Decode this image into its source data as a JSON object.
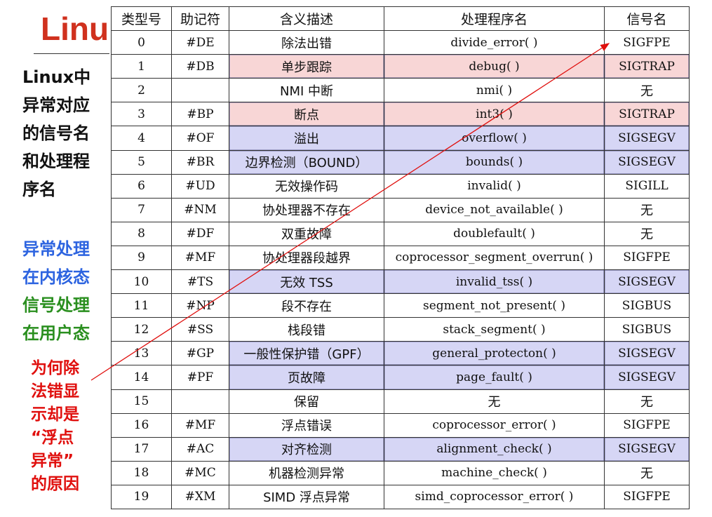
{
  "title": "Linu",
  "side_notes": {
    "intro": [
      "Linux中",
      "异常对应",
      "的信号名",
      "和处理程",
      "序名"
    ],
    "kernel": [
      "异常处理",
      "在内核态"
    ],
    "user": [
      "信号处理",
      "在用户态"
    ],
    "question": [
      "为何除",
      "法错显",
      "示却是",
      "“浮点",
      "异常”",
      "的原因"
    ]
  },
  "table": {
    "headers": [
      "类型号",
      "助记符",
      "含义描述",
      "处理程序名",
      "信号名"
    ],
    "rows": [
      {
        "num": "0",
        "mn": "#DE",
        "desc": "除法出错",
        "handler": "divide_error( )",
        "signal": "SIGFPE",
        "hl": ""
      },
      {
        "num": "1",
        "mn": "#DB",
        "desc": "单步跟踪",
        "handler": "debug( )",
        "signal": "SIGTRAP",
        "hl": "pink"
      },
      {
        "num": "2",
        "mn": "",
        "desc": "NMI 中断",
        "handler": "nmi( )",
        "signal": "无",
        "hl": ""
      },
      {
        "num": "3",
        "mn": "#BP",
        "desc": "断点",
        "handler": "int3( )",
        "signal": "SIGTRAP",
        "hl": "pink"
      },
      {
        "num": "4",
        "mn": "#OF",
        "desc": "溢出",
        "handler": "overflow( )",
        "signal": "SIGSEGV",
        "hl": "blue"
      },
      {
        "num": "5",
        "mn": "#BR",
        "desc": "边界检测（BOUND）",
        "handler": "bounds( )",
        "signal": "SIGSEGV",
        "hl": "blue"
      },
      {
        "num": "6",
        "mn": "#UD",
        "desc": "无效操作码",
        "handler": "invalid( )",
        "signal": "SIGILL",
        "hl": ""
      },
      {
        "num": "7",
        "mn": "#NM",
        "desc": "协处理器不存在",
        "handler": "device_not_available( )",
        "signal": "无",
        "hl": ""
      },
      {
        "num": "8",
        "mn": "#DF",
        "desc": "双重故障",
        "handler": "doublefault( )",
        "signal": "无",
        "hl": ""
      },
      {
        "num": "9",
        "mn": "#MF",
        "desc": "协处理器段越界",
        "handler": "coprocessor_segment_overrun( )",
        "signal": "SIGFPE",
        "hl": ""
      },
      {
        "num": "10",
        "mn": "#TS",
        "desc": "无效 TSS",
        "handler": "invalid_tss( )",
        "signal": "SIGSEGV",
        "hl": "blue"
      },
      {
        "num": "11",
        "mn": "#NP",
        "desc": "段不存在",
        "handler": "segment_not_present( )",
        "signal": "SIGBUS",
        "hl": ""
      },
      {
        "num": "12",
        "mn": "#SS",
        "desc": "栈段错",
        "handler": "stack_segment( )",
        "signal": "SIGBUS",
        "hl": ""
      },
      {
        "num": "13",
        "mn": "#GP",
        "desc": "一般性保护错（GPF）",
        "handler": "general_protecton( )",
        "signal": "SIGSEGV",
        "hl": "blue"
      },
      {
        "num": "14",
        "mn": "#PF",
        "desc": "页故障",
        "handler": "page_fault( )",
        "signal": "SIGSEGV",
        "hl": "blue"
      },
      {
        "num": "15",
        "mn": "",
        "desc": "保留",
        "handler": "无",
        "signal": "无",
        "hl": ""
      },
      {
        "num": "16",
        "mn": "#MF",
        "desc": "浮点错误",
        "handler": "coprocessor_error( )",
        "signal": "SIGFPE",
        "hl": ""
      },
      {
        "num": "17",
        "mn": "#AC",
        "desc": "对齐检测",
        "handler": "alignment_check( )",
        "signal": "SIGSEGV",
        "hl": "blue"
      },
      {
        "num": "18",
        "mn": "#MC",
        "desc": "机器检测异常",
        "handler": "machine_check( )",
        "signal": "无",
        "hl": ""
      },
      {
        "num": "19",
        "mn": "#XM",
        "desc": "SIMD 浮点异常",
        "handler": "simd_coprocessor_error( )",
        "signal": "SIGFPE",
        "hl": ""
      }
    ]
  },
  "colors": {
    "title": "#d0311e",
    "kernel_note": "#2d64e0",
    "user_note": "#2a8f1f",
    "question_note": "#e0100e",
    "pink_highlight": "#f8d6d6",
    "blue_highlight": "#d6d6f5",
    "arrow": "#e0100e"
  }
}
